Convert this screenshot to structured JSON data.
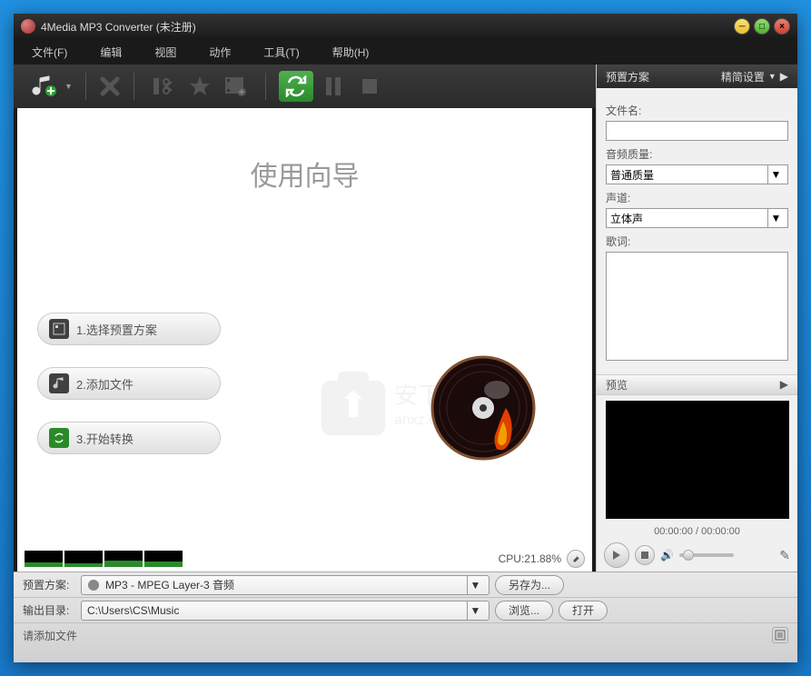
{
  "window": {
    "title": "4Media MP3 Converter (未注册)"
  },
  "menu": {
    "file": "文件(F)",
    "edit": "编辑",
    "view": "视图",
    "action": "动作",
    "tools": "工具(T)",
    "help": "帮助(H)"
  },
  "wizard": {
    "title": "使用向导",
    "step1": "1.选择预置方案",
    "step2": "2.添加文件",
    "step3": "3.开始转换"
  },
  "cpu": {
    "label": "CPU:21.88%"
  },
  "profile": {
    "header": "预置方案",
    "concise": "精简设置",
    "filename_label": "文件名:",
    "audio_quality_label": "音频质量:",
    "audio_quality_value": "普通质量",
    "channel_label": "声道:",
    "channel_value": "立体声",
    "lyrics_label": "歌词:"
  },
  "preview": {
    "header": "预览",
    "time": "00:00:00 / 00:00:00"
  },
  "bottom": {
    "profile_label": "预置方案:",
    "profile_value": "MP3 - MPEG Layer-3 音频",
    "saveas": "另存为...",
    "output_label": "输出目录:",
    "output_value": "C:\\Users\\CS\\Music",
    "browse": "浏览...",
    "open": "打开",
    "status": "请添加文件"
  }
}
